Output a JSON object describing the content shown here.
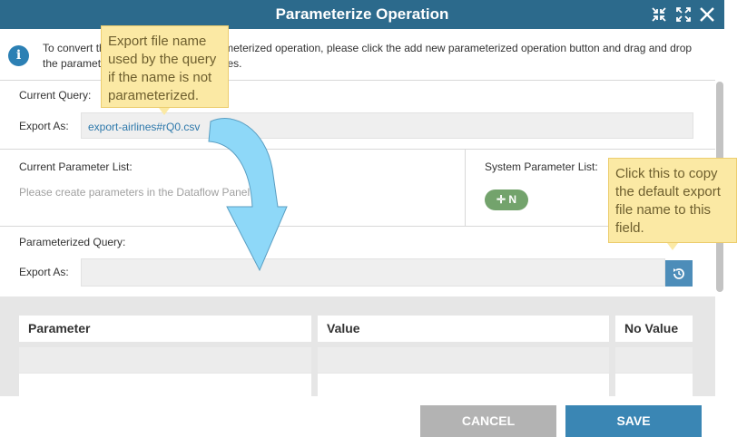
{
  "window": {
    "title": "Parameterize Operation",
    "controls": [
      "collapse-icon",
      "expand-icon",
      "close-icon"
    ]
  },
  "info": {
    "icon": "info-icon",
    "text": "To convert the current query to a parameterized operation, please click the add new parameterized operation button and drag and drop the parameters to the appropriate places."
  },
  "current_query": {
    "label": "Current Query:",
    "export_label": "Export As:",
    "export_value": "export-airlines#rQ0.csv"
  },
  "current_parameter_list": {
    "label": "Current Parameter List:",
    "placeholder": "Please create parameters in the Dataflow Panel first."
  },
  "system_parameter_list": {
    "label": "System Parameter List:",
    "badge": "N",
    "badge_icon": "move-icon"
  },
  "parameterized_query": {
    "label": "Parameterized Query:",
    "export_label": "Export As:",
    "export_value": "",
    "refresh_icon": "history-icon"
  },
  "table": {
    "columns": [
      "Parameter",
      "Value",
      "No Value"
    ]
  },
  "buttons": {
    "cancel": "CANCEL",
    "save": "SAVE"
  },
  "tooltips": {
    "export_name": "Export file name used by the query if the name is not parameterized.",
    "copy_default": "Click this to copy the default export file name to this field."
  },
  "colors": {
    "titlebar": "#2c6a8c",
    "cancel": "#b3b3b3",
    "save": "#3a86b4",
    "badge": "#73a36c",
    "tooltip": "#fbe9a4"
  }
}
